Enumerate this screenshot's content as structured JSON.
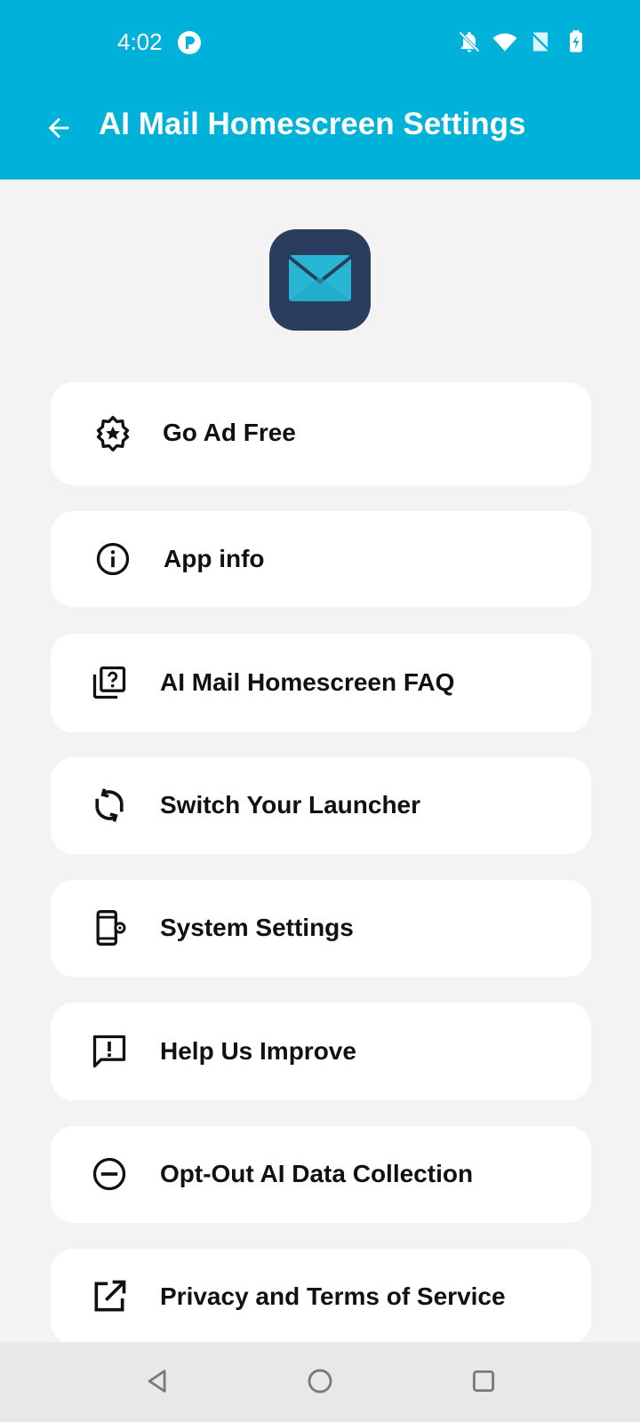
{
  "status_bar": {
    "time": "4:02",
    "icons": [
      "notifications-muted-icon",
      "wifi-icon",
      "no-sim-icon",
      "battery-charging-icon"
    ]
  },
  "toolbar": {
    "title": "AI Mail Homescreen Settings",
    "back_icon": "arrow-back-icon"
  },
  "colors": {
    "accent": "#00b2d9",
    "logo_bg": "#2a3d5e",
    "logo_mail": "#29b6d4",
    "background": "#f3f3f3",
    "card": "#ffffff"
  },
  "menu": [
    {
      "label": "Go Ad Free",
      "icon": "badge-star-icon"
    },
    {
      "label": "App info",
      "icon": "info-icon"
    },
    {
      "label": "AI Mail Homescreen FAQ",
      "icon": "faq-icon"
    },
    {
      "label": "Switch Your Launcher",
      "icon": "sync-icon"
    },
    {
      "label": "System Settings",
      "icon": "phone-settings-icon"
    },
    {
      "label": "Help Us Improve",
      "icon": "feedback-icon"
    },
    {
      "label": "Opt-Out AI Data Collection",
      "icon": "minus-circle-icon"
    },
    {
      "label": "Privacy and Terms of Service",
      "icon": "open-external-icon"
    }
  ],
  "nav_bar": {
    "buttons": [
      "back-nav-icon",
      "home-nav-icon",
      "recents-nav-icon"
    ]
  }
}
